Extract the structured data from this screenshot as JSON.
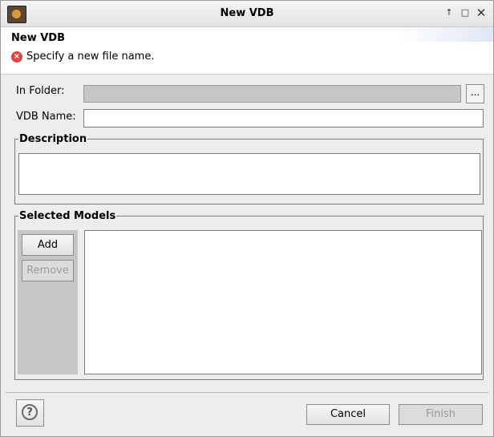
{
  "window": {
    "title": "New VDB",
    "controls": {
      "up_icon": "↑",
      "maximize_icon": "□",
      "close_icon": "✕"
    }
  },
  "header": {
    "title": "New VDB",
    "error_icon": "x-circle-icon",
    "error_glyph": "×",
    "message": "Specify a new file name."
  },
  "form": {
    "in_folder_label": "In Folder:",
    "in_folder_value": "",
    "browse_label": "...",
    "vdb_name_label": "VDB Name:",
    "vdb_name_value": ""
  },
  "description": {
    "title": "Description",
    "value": ""
  },
  "selected_models": {
    "title": "Selected Models",
    "add_label": "Add",
    "remove_label": "Remove",
    "items": []
  },
  "footer": {
    "help_glyph": "?",
    "cancel_label": "Cancel",
    "finish_label": "Finish"
  }
}
